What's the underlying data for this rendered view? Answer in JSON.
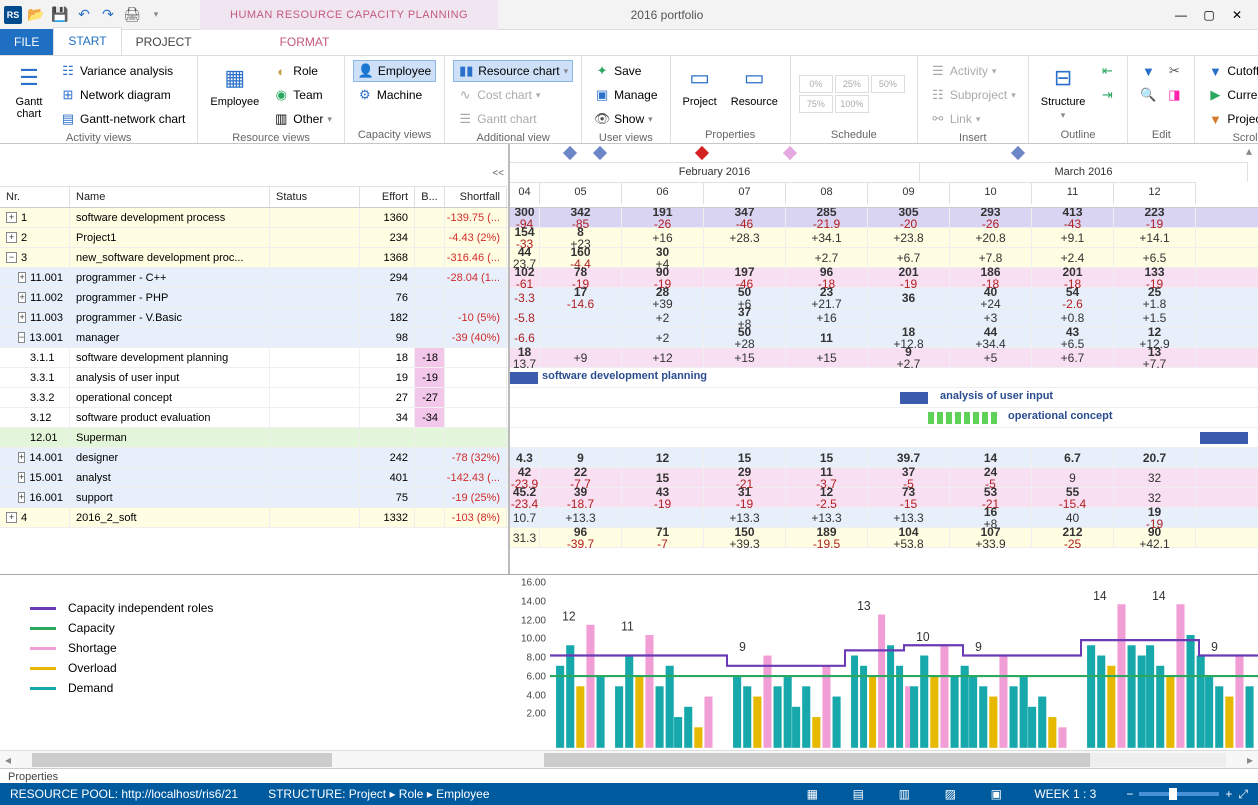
{
  "titlebar": {
    "context_tab": "HUMAN RESOURCE CAPACITY PLANNING",
    "doc_title": "2016 portfolio"
  },
  "tabs": {
    "file": "FILE",
    "start": "START",
    "project": "PROJECT",
    "format": "FORMAT"
  },
  "ribbon": {
    "activity_views": {
      "caption": "Activity views",
      "gantt_chart": "Gantt chart",
      "variance": "Variance analysis",
      "network": "Network diagram",
      "gantt_network": "Gantt-network chart"
    },
    "resource_views": {
      "caption": "Resource views",
      "employee": "Employee",
      "role": "Role",
      "team": "Team",
      "other": "Other"
    },
    "capacity_views": {
      "caption": "Capacity views",
      "employee_btn": "Employee",
      "machine": "Machine"
    },
    "additional_view": {
      "caption": "Additional view",
      "resource_chart": "Resource chart",
      "cost_chart": "Cost chart",
      "gantt": "Gantt chart"
    },
    "user_views": {
      "caption": "User views",
      "save": "Save",
      "manage": "Manage",
      "show": "Show"
    },
    "properties": {
      "caption": "Properties",
      "project": "Project",
      "resource": "Resource"
    },
    "schedule": {
      "caption": "Schedule",
      "pct": [
        "0%",
        "25%",
        "50%",
        "75%",
        "100%"
      ]
    },
    "insert": {
      "caption": "Insert",
      "activity": "Activity",
      "subproject": "Subproject",
      "link": "Link"
    },
    "outline": {
      "caption": "Outline",
      "structure": "Structure"
    },
    "edit": {
      "caption": "Edit"
    },
    "scrolling": {
      "caption": "Scrolling",
      "cutoff": "Cutoff date",
      "current": "Current date",
      "project_start": "Project start"
    }
  },
  "grid": {
    "headers": {
      "nr": "Nr.",
      "name": "Name",
      "status": "Status",
      "effort": "Effort",
      "b": "B...",
      "shortfall": "Shortfall"
    },
    "rows": [
      {
        "nr": "1",
        "toggle": "+",
        "name": "software development process",
        "effort": "1360",
        "shortfall": "-139.75 (...",
        "cls": "row-yellow",
        "lvl": 0
      },
      {
        "nr": "2",
        "toggle": "+",
        "name": "Project1",
        "effort": "234",
        "shortfall": "-4.43 (2%)",
        "cls": "row-yellow",
        "lvl": 0
      },
      {
        "nr": "3",
        "toggle": "-",
        "name": "new_software development proc...",
        "effort": "1368",
        "shortfall": "-316.46 (...",
        "cls": "row-yellow",
        "lvl": 0
      },
      {
        "nr": "11.001",
        "toggle": "+",
        "name": "programmer - C++",
        "effort": "294",
        "shortfall": "-28.04 (1...",
        "cls": "row-blue",
        "lvl": 1
      },
      {
        "nr": "11.002",
        "toggle": "+",
        "name": "programmer - PHP",
        "effort": "76",
        "shortfall": "",
        "cls": "row-blue",
        "lvl": 1
      },
      {
        "nr": "11.003",
        "toggle": "+",
        "name": "programmer - V.Basic",
        "effort": "182",
        "shortfall": "-10 (5%)",
        "cls": "row-blue",
        "lvl": 1
      },
      {
        "nr": "13.001",
        "toggle": "-",
        "name": "manager",
        "effort": "98",
        "shortfall": "-39 (40%)",
        "cls": "row-blue",
        "lvl": 1
      },
      {
        "nr": "3.1.1",
        "toggle": "",
        "name": "software development planning",
        "effort": "18",
        "b": "-18",
        "shortfall": "",
        "cls": "",
        "lvl": 2
      },
      {
        "nr": "3.3.1",
        "toggle": "",
        "name": "analysis of user input",
        "effort": "19",
        "b": "-19",
        "shortfall": "",
        "cls": "",
        "lvl": 2
      },
      {
        "nr": "3.3.2",
        "toggle": "",
        "name": "operational concept",
        "effort": "27",
        "b": "-27",
        "shortfall": "",
        "cls": "",
        "lvl": 2
      },
      {
        "nr": "3.12",
        "toggle": "",
        "name": "software product evaluation",
        "effort": "34",
        "b": "-34",
        "shortfall": "",
        "cls": "",
        "lvl": 2
      },
      {
        "nr": "12.01",
        "toggle": "",
        "name": "Superman",
        "effort": "",
        "shortfall": "",
        "cls": "row-green",
        "lvl": 2
      },
      {
        "nr": "14.001",
        "toggle": "+",
        "name": "designer",
        "effort": "242",
        "shortfall": "-78 (32%)",
        "cls": "row-blue",
        "lvl": 1
      },
      {
        "nr": "15.001",
        "toggle": "+",
        "name": "analyst",
        "effort": "401",
        "shortfall": "-142.43 (...",
        "cls": "row-blue",
        "lvl": 1
      },
      {
        "nr": "16.001",
        "toggle": "+",
        "name": "support",
        "effort": "75",
        "shortfall": "-19 (25%)",
        "cls": "row-blue",
        "lvl": 1
      },
      {
        "nr": "4",
        "toggle": "+",
        "name": "2016_2_soft",
        "effort": "1332",
        "shortfall": "-103 (8%)",
        "cls": "row-yellow",
        "lvl": 0
      }
    ]
  },
  "timeline": {
    "months": [
      {
        "label": "February 2016",
        "span": 5
      },
      {
        "label": "March 2016",
        "span": 4
      }
    ],
    "days": [
      "04",
      "05",
      "06",
      "07",
      "08",
      "09",
      "10",
      "11",
      "12"
    ],
    "diamonds": [
      {
        "x": 55,
        "color": "#6d86c8"
      },
      {
        "x": 85,
        "color": "#6d86c8"
      },
      {
        "x": 187,
        "color": "#d42020"
      },
      {
        "x": 275,
        "color": "#e6a8e0"
      },
      {
        "x": 503,
        "color": "#6d86c8"
      }
    ],
    "gantt_labels": {
      "sdp": "software development planning",
      "aui": "analysis of user input",
      "oc": "operational concept"
    },
    "rows": [
      {
        "bg": "bg-purple",
        "vals": [
          [
            "300",
            "-94"
          ],
          [
            "342",
            "-85"
          ],
          [
            "191",
            "-26"
          ],
          [
            "347",
            "-46"
          ],
          [
            "285",
            "-21.9"
          ],
          [
            "305",
            "-20"
          ],
          [
            "293",
            "-26"
          ],
          [
            "413",
            "-43"
          ],
          [
            "223",
            "-19"
          ]
        ]
      },
      {
        "bg": "bg-yellow",
        "vals": [
          [
            "154",
            "-33"
          ],
          [
            "8",
            "+23"
          ],
          [
            "",
            "+16"
          ],
          [
            "",
            "+28.3"
          ],
          [
            "",
            "+34.1"
          ],
          [
            "",
            "+23.8"
          ],
          [
            "",
            "+20.8"
          ],
          [
            "",
            "+9.1"
          ],
          [
            "",
            "+14.1"
          ]
        ]
      },
      {
        "bg": "bg-yellow",
        "vals": [
          [
            "44",
            "23.7"
          ],
          [
            "160",
            "-4.4"
          ],
          [
            "30",
            "+4"
          ],
          [
            "",
            ""
          ],
          [
            "",
            "+2.7"
          ],
          [
            "",
            "+6.7"
          ],
          [
            "",
            "+7.8"
          ],
          [
            "",
            "+2.4"
          ],
          [
            "",
            "+6.5"
          ]
        ]
      },
      {
        "bg": "bg-pink",
        "vals": [
          [
            "102",
            "-61"
          ],
          [
            "78",
            "-19"
          ],
          [
            "90",
            "-19"
          ],
          [
            "197",
            "-46"
          ],
          [
            "96",
            "-18"
          ],
          [
            "201",
            "-19"
          ],
          [
            "186",
            "-18"
          ],
          [
            "201",
            "-18"
          ],
          [
            "133",
            "-19"
          ]
        ]
      },
      {
        "bg": "bg-ltblue",
        "vals": [
          [
            "",
            "-3.3"
          ],
          [
            "17",
            "-14.6"
          ],
          [
            "28",
            "+39"
          ],
          [
            "50",
            "+6"
          ],
          [
            "23",
            "+21.7"
          ],
          [
            "36",
            ""
          ],
          [
            "40",
            "+24"
          ],
          [
            "54",
            "-2.6"
          ],
          [
            "25",
            "+1.8"
          ]
        ]
      },
      {
        "bg": "bg-ltblue",
        "vals": [
          [
            "",
            "-5.8"
          ],
          [
            "",
            ""
          ],
          [
            "",
            "+2"
          ],
          [
            "37",
            "+8"
          ],
          [
            "",
            "+16"
          ],
          [
            "",
            ""
          ],
          [
            "",
            "+3"
          ],
          [
            "",
            "+0.8"
          ],
          [
            "",
            "+1.5"
          ]
        ]
      },
      {
        "bg": "bg-ltblue",
        "vals": [
          [
            "",
            "-6.6"
          ],
          [
            "",
            ""
          ],
          [
            "",
            "+2"
          ],
          [
            "50",
            "+28"
          ],
          [
            "11",
            ""
          ],
          [
            "18",
            "+12.8"
          ],
          [
            "44",
            "+34.4"
          ],
          [
            "43",
            "+6.5"
          ],
          [
            "12",
            "+12.9"
          ]
        ]
      },
      {
        "bg": "bg-pink",
        "vals": [
          [
            "18",
            "13.7"
          ],
          [
            "",
            "+9"
          ],
          [
            "",
            "+12"
          ],
          [
            "",
            "+15"
          ],
          [
            "",
            "+15"
          ],
          [
            "9",
            "+2.7"
          ],
          [
            "",
            "+5"
          ],
          [
            "",
            "+6.7"
          ],
          [
            "13",
            "+7.7"
          ]
        ]
      },
      {
        "bg": "bg-white",
        "type": "bar",
        "bar": {
          "left": 0,
          "w": 28,
          "color": "#3b5cad"
        },
        "label": "sdp",
        "lx": 32
      },
      {
        "bg": "bg-white",
        "type": "bar",
        "bar": {
          "left": 390,
          "w": 28,
          "color": "#3b5cad"
        },
        "label": "aui",
        "lx": 430
      },
      {
        "bg": "bg-white",
        "type": "bar",
        "bar": {
          "left": 418,
          "w": 72,
          "color": "#5ed157",
          "stripe": true
        },
        "label": "oc",
        "lx": 498
      },
      {
        "bg": "bg-white",
        "type": "bar",
        "bar": {
          "left": 690,
          "w": 48,
          "color": "#3b5cad"
        }
      },
      {
        "bg": "bg-ltblue",
        "vals": [
          [
            "4.3",
            ""
          ],
          [
            "9",
            ""
          ],
          [
            "12",
            ""
          ],
          [
            "15",
            ""
          ],
          [
            "15",
            ""
          ],
          [
            "39.7",
            ""
          ],
          [
            "14",
            ""
          ],
          [
            "6.7",
            ""
          ],
          [
            "20.7",
            ""
          ]
        ]
      },
      {
        "bg": "bg-pink",
        "vals": [
          [
            "42",
            "-23.9"
          ],
          [
            "22",
            "-7.7"
          ],
          [
            "15",
            ""
          ],
          [
            "29",
            "-21"
          ],
          [
            "11",
            "-3.7"
          ],
          [
            "37",
            "-5"
          ],
          [
            "24",
            "-5"
          ],
          [
            "",
            "9"
          ],
          [
            "",
            "32"
          ]
        ]
      },
      {
        "bg": "bg-pink",
        "vals": [
          [
            "45.2",
            "-23.4"
          ],
          [
            "39",
            "-18.7"
          ],
          [
            "43",
            "-19"
          ],
          [
            "31",
            "-19"
          ],
          [
            "12",
            "-2.5"
          ],
          [
            "73",
            "-15"
          ],
          [
            "53",
            "-21"
          ],
          [
            "55",
            "-15.4"
          ],
          [
            "",
            "32"
          ]
        ]
      },
      {
        "bg": "bg-ltblue",
        "vals": [
          [
            "",
            "10.7"
          ],
          [
            "",
            "+13.3"
          ],
          [
            "",
            ""
          ],
          [
            "",
            "+13.3"
          ],
          [
            "",
            "+13.3"
          ],
          [
            "",
            "+13.3"
          ],
          [
            "16",
            "+8"
          ],
          [
            "",
            "40"
          ],
          [
            "19",
            "-19"
          ]
        ]
      },
      {
        "bg": "bg-yellow",
        "vals": [
          [
            "",
            "31.3"
          ],
          [
            "96",
            "-39.7"
          ],
          [
            "71",
            "-7"
          ],
          [
            "150",
            "+39.3"
          ],
          [
            "189",
            "-19.5"
          ],
          [
            "104",
            "+53.8"
          ],
          [
            "107",
            "+33.9"
          ],
          [
            "212",
            "-25"
          ],
          [
            "90",
            "+42.1"
          ]
        ]
      }
    ]
  },
  "chart_data": {
    "type": "bar",
    "ylim": [
      0,
      16
    ],
    "ticks": [
      "16.00",
      "14.00",
      "12.00",
      "10.00",
      "8.00",
      "6.00",
      "4.00",
      "2.00"
    ],
    "legend": [
      {
        "label": "Capacity independent roles",
        "color": "#6b3ab5"
      },
      {
        "label": "Capacity",
        "color": "#2aa85f"
      },
      {
        "label": "Shortage",
        "color": "#f29ed6"
      },
      {
        "label": "Overload",
        "color": "#e6b800"
      },
      {
        "label": "Demand",
        "color": "#17a8ab"
      }
    ],
    "labels": [
      12,
      11,
      "",
      9,
      "",
      13,
      10,
      9,
      "",
      14,
      14,
      9
    ],
    "capacity_line_y": 7,
    "indep_line": [
      9,
      9,
      9,
      8,
      8,
      9.5,
      10,
      9,
      9,
      10.5,
      10.5,
      9,
      9
    ],
    "groups": [
      [
        8,
        10,
        6,
        12,
        7
      ],
      [
        6,
        9,
        7,
        11,
        6,
        8
      ],
      [
        3,
        4,
        2,
        5
      ],
      [
        7,
        6,
        5,
        9,
        6,
        7
      ],
      [
        4,
        6,
        3,
        8,
        5
      ],
      [
        9,
        8,
        7,
        13,
        10,
        8,
        6
      ],
      [
        6,
        9,
        7,
        10,
        7,
        8
      ],
      [
        7,
        6,
        5,
        9,
        6,
        7
      ],
      [
        4,
        5,
        3,
        2
      ],
      [
        10,
        9,
        8,
        14,
        10,
        9
      ],
      [
        10,
        8,
        7,
        14,
        11,
        9
      ],
      [
        7,
        6,
        5,
        9,
        6
      ]
    ]
  },
  "props": "Properties",
  "status": {
    "pool": "RESOURCE POOL: http://localhost/ris6/21",
    "structure": "STRUCTURE: Project ▸ Role ▸ Employee",
    "week": "WEEK 1 : 3"
  }
}
